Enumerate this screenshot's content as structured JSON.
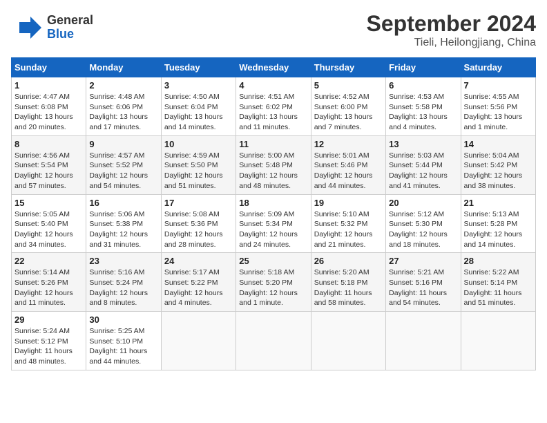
{
  "header": {
    "logo_general": "General",
    "logo_blue": "Blue",
    "title": "September 2024",
    "subtitle": "Tieli, Heilongjiang, China"
  },
  "calendar": {
    "days_of_week": [
      "Sunday",
      "Monday",
      "Tuesday",
      "Wednesday",
      "Thursday",
      "Friday",
      "Saturday"
    ],
    "weeks": [
      [
        {
          "day": "1",
          "info": "Sunrise: 4:47 AM\nSunset: 6:08 PM\nDaylight: 13 hours and 20 minutes."
        },
        {
          "day": "2",
          "info": "Sunrise: 4:48 AM\nSunset: 6:06 PM\nDaylight: 13 hours and 17 minutes."
        },
        {
          "day": "3",
          "info": "Sunrise: 4:50 AM\nSunset: 6:04 PM\nDaylight: 13 hours and 14 minutes."
        },
        {
          "day": "4",
          "info": "Sunrise: 4:51 AM\nSunset: 6:02 PM\nDaylight: 13 hours and 11 minutes."
        },
        {
          "day": "5",
          "info": "Sunrise: 4:52 AM\nSunset: 6:00 PM\nDaylight: 13 hours and 7 minutes."
        },
        {
          "day": "6",
          "info": "Sunrise: 4:53 AM\nSunset: 5:58 PM\nDaylight: 13 hours and 4 minutes."
        },
        {
          "day": "7",
          "info": "Sunrise: 4:55 AM\nSunset: 5:56 PM\nDaylight: 13 hours and 1 minute."
        }
      ],
      [
        {
          "day": "8",
          "info": "Sunrise: 4:56 AM\nSunset: 5:54 PM\nDaylight: 12 hours and 57 minutes."
        },
        {
          "day": "9",
          "info": "Sunrise: 4:57 AM\nSunset: 5:52 PM\nDaylight: 12 hours and 54 minutes."
        },
        {
          "day": "10",
          "info": "Sunrise: 4:59 AM\nSunset: 5:50 PM\nDaylight: 12 hours and 51 minutes."
        },
        {
          "day": "11",
          "info": "Sunrise: 5:00 AM\nSunset: 5:48 PM\nDaylight: 12 hours and 48 minutes."
        },
        {
          "day": "12",
          "info": "Sunrise: 5:01 AM\nSunset: 5:46 PM\nDaylight: 12 hours and 44 minutes."
        },
        {
          "day": "13",
          "info": "Sunrise: 5:03 AM\nSunset: 5:44 PM\nDaylight: 12 hours and 41 minutes."
        },
        {
          "day": "14",
          "info": "Sunrise: 5:04 AM\nSunset: 5:42 PM\nDaylight: 12 hours and 38 minutes."
        }
      ],
      [
        {
          "day": "15",
          "info": "Sunrise: 5:05 AM\nSunset: 5:40 PM\nDaylight: 12 hours and 34 minutes."
        },
        {
          "day": "16",
          "info": "Sunrise: 5:06 AM\nSunset: 5:38 PM\nDaylight: 12 hours and 31 minutes."
        },
        {
          "day": "17",
          "info": "Sunrise: 5:08 AM\nSunset: 5:36 PM\nDaylight: 12 hours and 28 minutes."
        },
        {
          "day": "18",
          "info": "Sunrise: 5:09 AM\nSunset: 5:34 PM\nDaylight: 12 hours and 24 minutes."
        },
        {
          "day": "19",
          "info": "Sunrise: 5:10 AM\nSunset: 5:32 PM\nDaylight: 12 hours and 21 minutes."
        },
        {
          "day": "20",
          "info": "Sunrise: 5:12 AM\nSunset: 5:30 PM\nDaylight: 12 hours and 18 minutes."
        },
        {
          "day": "21",
          "info": "Sunrise: 5:13 AM\nSunset: 5:28 PM\nDaylight: 12 hours and 14 minutes."
        }
      ],
      [
        {
          "day": "22",
          "info": "Sunrise: 5:14 AM\nSunset: 5:26 PM\nDaylight: 12 hours and 11 minutes."
        },
        {
          "day": "23",
          "info": "Sunrise: 5:16 AM\nSunset: 5:24 PM\nDaylight: 12 hours and 8 minutes."
        },
        {
          "day": "24",
          "info": "Sunrise: 5:17 AM\nSunset: 5:22 PM\nDaylight: 12 hours and 4 minutes."
        },
        {
          "day": "25",
          "info": "Sunrise: 5:18 AM\nSunset: 5:20 PM\nDaylight: 12 hours and 1 minute."
        },
        {
          "day": "26",
          "info": "Sunrise: 5:20 AM\nSunset: 5:18 PM\nDaylight: 11 hours and 58 minutes."
        },
        {
          "day": "27",
          "info": "Sunrise: 5:21 AM\nSunset: 5:16 PM\nDaylight: 11 hours and 54 minutes."
        },
        {
          "day": "28",
          "info": "Sunrise: 5:22 AM\nSunset: 5:14 PM\nDaylight: 11 hours and 51 minutes."
        }
      ],
      [
        {
          "day": "29",
          "info": "Sunrise: 5:24 AM\nSunset: 5:12 PM\nDaylight: 11 hours and 48 minutes."
        },
        {
          "day": "30",
          "info": "Sunrise: 5:25 AM\nSunset: 5:10 PM\nDaylight: 11 hours and 44 minutes."
        },
        {
          "day": "",
          "info": ""
        },
        {
          "day": "",
          "info": ""
        },
        {
          "day": "",
          "info": ""
        },
        {
          "day": "",
          "info": ""
        },
        {
          "day": "",
          "info": ""
        }
      ]
    ]
  }
}
